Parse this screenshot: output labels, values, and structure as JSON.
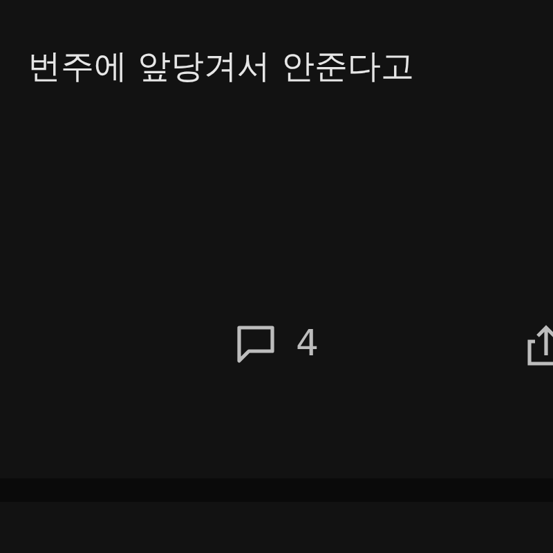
{
  "post": {
    "body_line": "번주에 앞당겨서 안준다고"
  },
  "actions": {
    "comment_count": "4"
  }
}
